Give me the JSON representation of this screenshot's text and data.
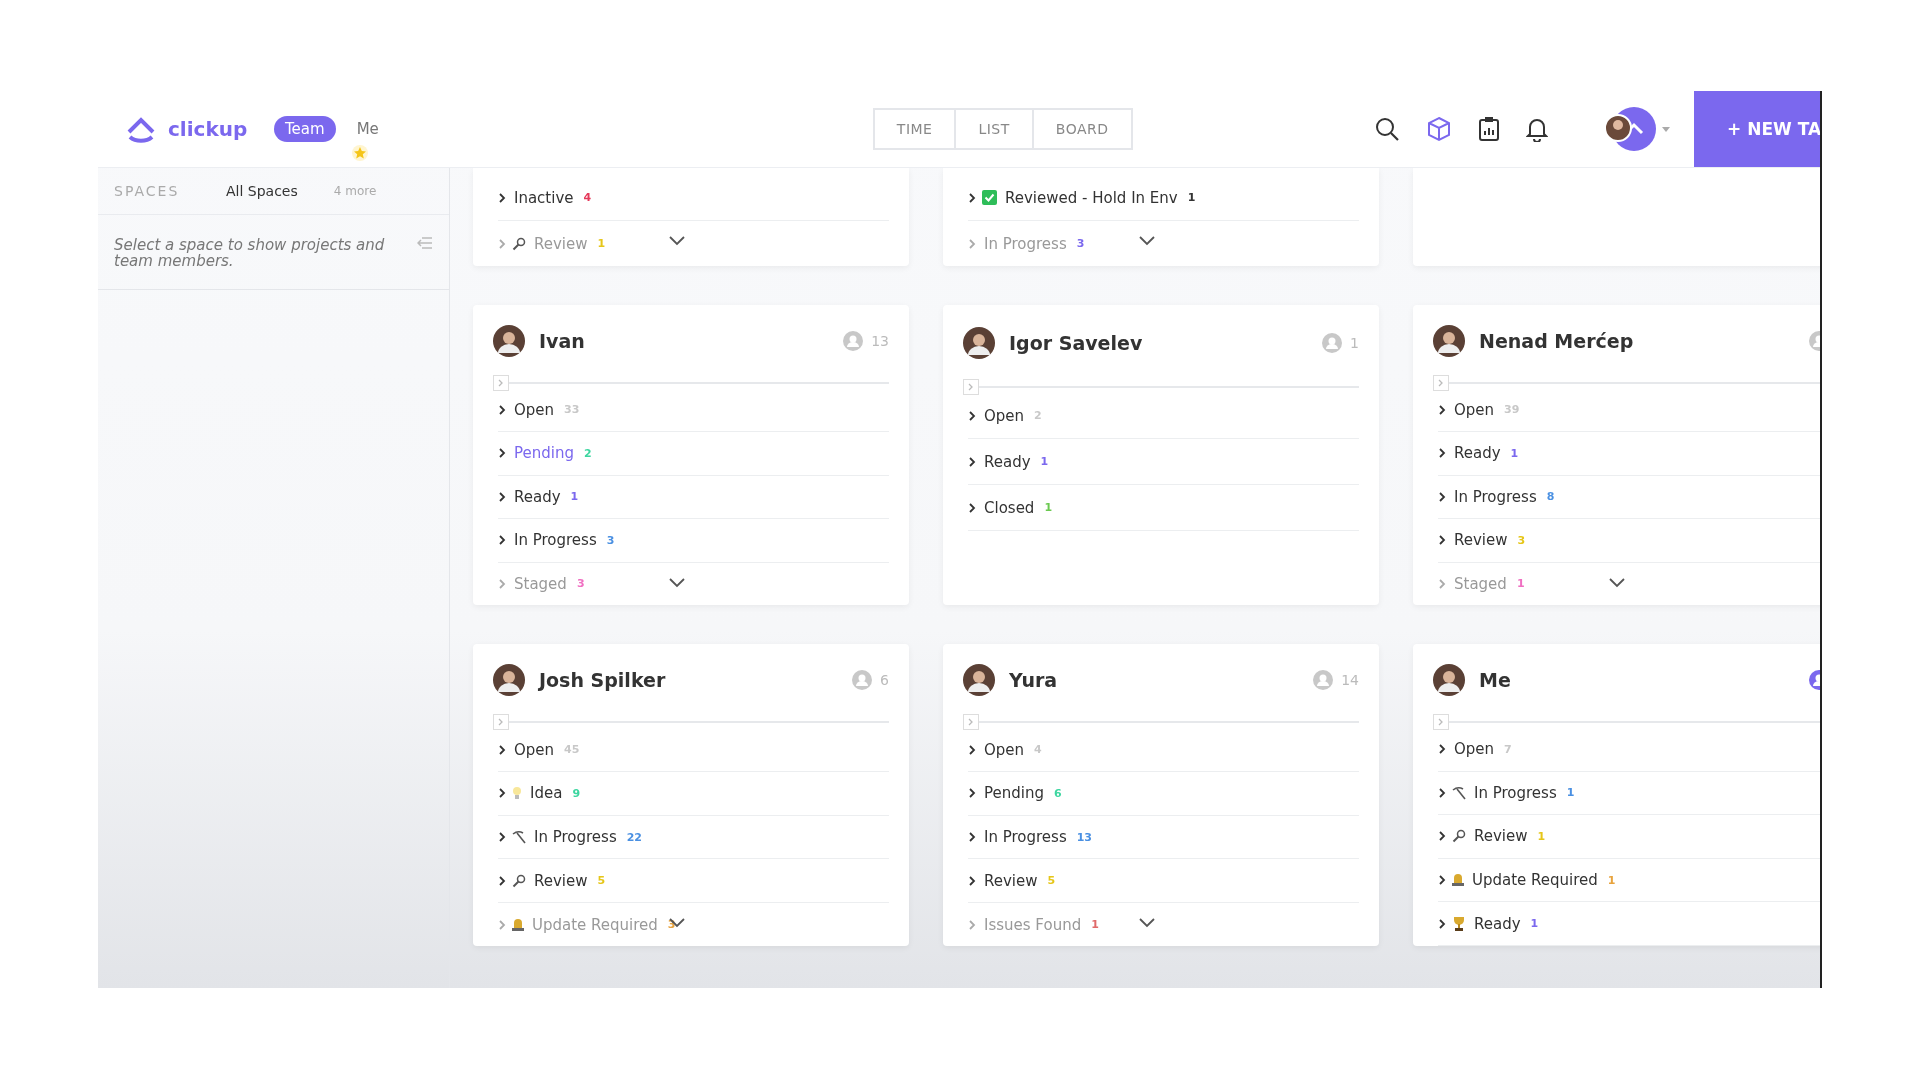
{
  "brand": {
    "name": "clickup"
  },
  "scope_tabs": [
    {
      "label": "Team",
      "selected": true
    },
    {
      "label": "Me",
      "selected": false
    }
  ],
  "view_tabs": [
    {
      "label": "TIME",
      "selected": false
    },
    {
      "label": "LIST",
      "selected": false
    },
    {
      "label": "BOARD",
      "selected": false
    }
  ],
  "new_task_button": "+ NEW TA",
  "sidebar": {
    "spaces_label": "SPACES",
    "tabs": [
      {
        "label": "All Spaces",
        "selected": true
      },
      {
        "label": "4 more",
        "selected": false
      }
    ],
    "hint": "Select a space to show projects and team members."
  },
  "top_cards": [
    {
      "collapsed": true,
      "statuses": [
        {
          "label": "Inactive",
          "count": "4",
          "color": "#e5395a",
          "kind": "plain",
          "hovered": false
        },
        {
          "label": "Review",
          "count": "1",
          "color": "#e6c619",
          "kind": "key",
          "hovered": false
        }
      ]
    },
    {
      "collapsed": true,
      "statuses": [
        {
          "label": "Reviewed - Hold In Env",
          "count": "1",
          "color": "#333333",
          "kind": "checkbox",
          "hovered": false
        },
        {
          "label": "In Progress",
          "count": "3",
          "color": "#7b68ee",
          "kind": "plain",
          "hovered": false
        }
      ]
    }
  ],
  "members": [
    {
      "name": "Ivan",
      "count": "13",
      "me": false,
      "collapsed": true,
      "statuses": [
        {
          "label": "Open",
          "count": "33",
          "color": "#c8c8c8",
          "kind": "plain",
          "hovered": false
        },
        {
          "label": "Pending",
          "count": "2",
          "color": "#3dd6a0",
          "kind": "plain",
          "hovered": true
        },
        {
          "label": "Ready",
          "count": "1",
          "color": "#7b68ee",
          "kind": "plain",
          "hovered": false
        },
        {
          "label": "In Progress",
          "count": "3",
          "color": "#4a90e2",
          "kind": "plain",
          "hovered": false
        },
        {
          "label": "Staged",
          "count": "3",
          "color": "#f06fc2",
          "kind": "plain",
          "hovered": false
        }
      ]
    },
    {
      "name": "Igor Savelev",
      "count": "1",
      "me": false,
      "collapsed": false,
      "statuses": [
        {
          "label": "Open",
          "count": "2",
          "color": "#c8c8c8",
          "kind": "plain",
          "hovered": false
        },
        {
          "label": "Ready",
          "count": "1",
          "color": "#7b68ee",
          "kind": "plain",
          "hovered": false
        },
        {
          "label": "Closed",
          "count": "1",
          "color": "#6bc950",
          "kind": "plain",
          "hovered": false
        }
      ]
    },
    {
      "name": "Nenad Merćep",
      "me": false,
      "collapsed": true,
      "statuses": [
        {
          "label": "Open",
          "count": "39",
          "color": "#c8c8c8",
          "kind": "plain",
          "hovered": false
        },
        {
          "label": "Ready",
          "count": "1",
          "color": "#7b68ee",
          "kind": "plain",
          "hovered": false
        },
        {
          "label": "In Progress",
          "count": "8",
          "color": "#4a90e2",
          "kind": "plain",
          "hovered": false
        },
        {
          "label": "Review",
          "count": "3",
          "color": "#e6c619",
          "kind": "plain",
          "hovered": false
        },
        {
          "label": "Staged",
          "count": "1",
          "color": "#f06fc2",
          "kind": "plain",
          "hovered": false
        }
      ]
    },
    {
      "name": "Josh Spilker",
      "count": "6",
      "me": false,
      "collapsed": true,
      "statuses": [
        {
          "label": "Open",
          "count": "45",
          "color": "#c8c8c8",
          "kind": "plain",
          "hovered": false
        },
        {
          "label": "Idea",
          "count": "9",
          "color": "#3dd6a0",
          "kind": "bulb",
          "hovered": false
        },
        {
          "label": "In Progress",
          "count": "22",
          "color": "#4a90e2",
          "kind": "pickaxe",
          "hovered": false
        },
        {
          "label": "Review",
          "count": "5",
          "color": "#e6c619",
          "kind": "key",
          "hovered": false
        },
        {
          "label": "Update Required",
          "count": "3",
          "color": "#e8a33d",
          "kind": "bell",
          "hovered": false
        }
      ]
    },
    {
      "name": "Yura",
      "count": "14",
      "me": false,
      "collapsed": true,
      "statuses": [
        {
          "label": "Open",
          "count": "4",
          "color": "#c8c8c8",
          "kind": "plain",
          "hovered": false
        },
        {
          "label": "Pending",
          "count": "6",
          "color": "#3dd6a0",
          "kind": "plain",
          "hovered": false
        },
        {
          "label": "In Progress",
          "count": "13",
          "color": "#4a90e2",
          "kind": "plain",
          "hovered": false
        },
        {
          "label": "Review",
          "count": "5",
          "color": "#e6c619",
          "kind": "plain",
          "hovered": false
        },
        {
          "label": "Issues Found",
          "count": "1",
          "color": "#e06a6a",
          "kind": "plain",
          "hovered": false
        }
      ]
    },
    {
      "name": "Me",
      "me": true,
      "collapsed": false,
      "statuses": [
        {
          "label": "Open",
          "count": "7",
          "color": "#c8c8c8",
          "kind": "plain",
          "hovered": false
        },
        {
          "label": "In Progress",
          "count": "1",
          "color": "#4a90e2",
          "kind": "pickaxe",
          "hovered": false
        },
        {
          "label": "Review",
          "count": "1",
          "color": "#e6c619",
          "kind": "key",
          "hovered": false
        },
        {
          "label": "Update Required",
          "count": "1",
          "color": "#e8a33d",
          "kind": "bell",
          "hovered": false
        },
        {
          "label": "Ready",
          "count": "1",
          "color": "#7b68ee",
          "kind": "trophy",
          "hovered": false
        }
      ]
    }
  ]
}
